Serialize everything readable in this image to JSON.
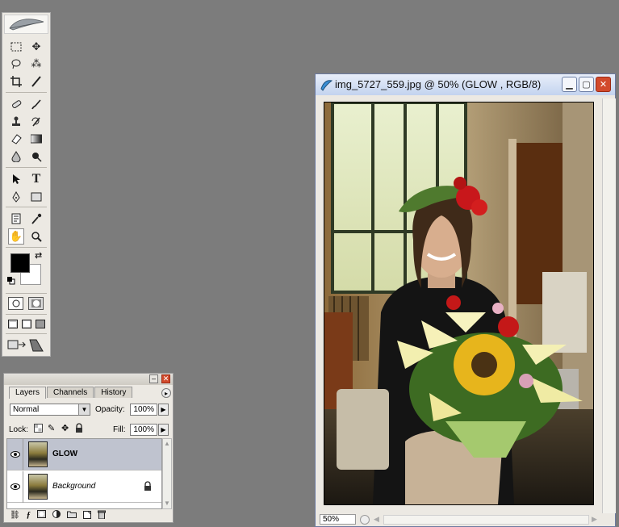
{
  "toolbox": {
    "tools": [
      {
        "name": "marquee-icon",
        "glyph": "⬚"
      },
      {
        "name": "move-icon",
        "glyph": "✥"
      },
      {
        "name": "lasso-icon",
        "glyph": "ℓ"
      },
      {
        "name": "magic-wand-icon",
        "glyph": "⁂"
      },
      {
        "name": "crop-icon",
        "glyph": "⌗"
      },
      {
        "name": "slice-icon",
        "glyph": "⟋"
      },
      {
        "name": "healing-brush-icon",
        "glyph": "✚"
      },
      {
        "name": "brush-icon",
        "glyph": "✎"
      },
      {
        "name": "clone-stamp-icon",
        "glyph": "♜"
      },
      {
        "name": "history-brush-icon",
        "glyph": "↺"
      },
      {
        "name": "eraser-icon",
        "glyph": "◇"
      },
      {
        "name": "gradient-icon",
        "glyph": "▤"
      },
      {
        "name": "blur-icon",
        "glyph": "◢"
      },
      {
        "name": "dodge-icon",
        "glyph": "●"
      },
      {
        "name": "path-selection-icon",
        "glyph": "➤"
      },
      {
        "name": "type-tool-icon",
        "glyph": "T"
      },
      {
        "name": "pen-icon",
        "glyph": "✒"
      },
      {
        "name": "shape-icon",
        "glyph": "▭"
      },
      {
        "name": "notes-icon",
        "glyph": "▦"
      },
      {
        "name": "eyedropper-icon",
        "glyph": "⟋"
      },
      {
        "name": "hand-icon",
        "glyph": "✋"
      },
      {
        "name": "zoom-icon",
        "glyph": "⚲"
      }
    ]
  },
  "layers_panel": {
    "tabs": [
      "Layers",
      "Channels",
      "History"
    ],
    "blend_mode": "Normal",
    "opacity_label": "Opacity:",
    "opacity_value": "100%",
    "lock_label": "Lock:",
    "fill_label": "Fill:",
    "fill_value": "100%",
    "layers": [
      {
        "name": "GLOW",
        "selected": true
      },
      {
        "name": "Background",
        "selected": false,
        "locked": true
      }
    ]
  },
  "document": {
    "title": "img_5727_559.jpg @ 50% (GLOW , RGB/8)",
    "zoom": "50%"
  },
  "colors": {
    "workspace": "#7c7c7c",
    "panel": "#ece9e3",
    "close_button": "#d24a2c",
    "selected_layer": "#bfc3cf"
  }
}
